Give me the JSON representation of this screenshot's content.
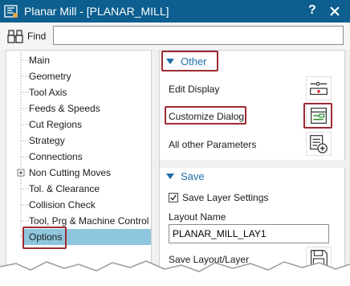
{
  "window": {
    "title": "Planar Mill - [PLANAR_MILL]",
    "help_glyph": "?",
    "app_icon": "nx-app-icon",
    "close_icon": "close-icon"
  },
  "findbar": {
    "label": "Find",
    "value": "",
    "icon": "binoculars-icon"
  },
  "nav": {
    "items": [
      {
        "label": "Main"
      },
      {
        "label": "Geometry"
      },
      {
        "label": "Tool Axis"
      },
      {
        "label": "Feeds & Speeds"
      },
      {
        "label": "Cut Regions"
      },
      {
        "label": "Strategy"
      },
      {
        "label": "Connections"
      },
      {
        "label": "Non Cutting Moves"
      },
      {
        "label": "Tol. & Clearance"
      },
      {
        "label": "Collision Check"
      },
      {
        "label": "Tool, Prg & Machine Control"
      },
      {
        "label": "Options"
      }
    ],
    "selected": "Options"
  },
  "other_section": {
    "title": "Other",
    "edit_display": {
      "label": "Edit Display",
      "icon": "edit-display-icon"
    },
    "customize_dialog": {
      "label": "Customize Dialog",
      "icon": "customize-dialog-icon"
    },
    "all_other_params": {
      "label": "All other Parameters",
      "icon": "all-parameters-icon"
    }
  },
  "save_section": {
    "title": "Save",
    "save_layer_settings": {
      "label": "Save Layer Settings",
      "checked": true
    },
    "layout_name": {
      "label": "Layout Name",
      "value": "PLANAR_MILL_LAY1"
    },
    "save_layout": {
      "label": "Save Layout/Layer",
      "icon": "floppy-disk-icon"
    }
  },
  "colors": {
    "titlebar": "#0c5f8f",
    "section_heading": "#1f6fa8",
    "selection": "#8ec6dd",
    "callout": "#9e2b31"
  }
}
